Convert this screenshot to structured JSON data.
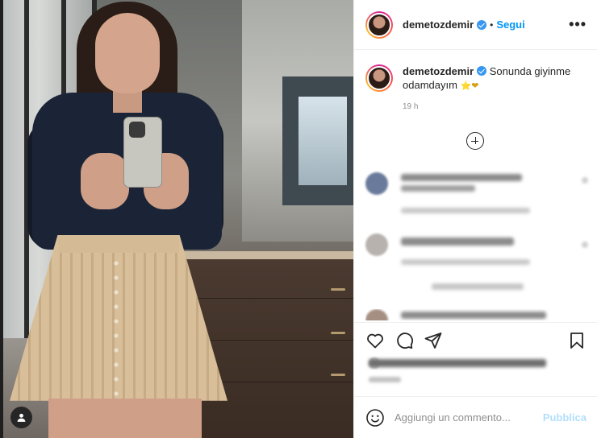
{
  "post": {
    "username": "demetozdemir",
    "follow_label": "Segui",
    "separator": "•",
    "more_label": "•••",
    "caption_text": "Sonunda giyinme odamdayım",
    "caption_emoji": "⭐❤",
    "time_ago": "19 h"
  },
  "composer": {
    "placeholder": "Aggiungi un commento...",
    "publish_label": "Pubblica"
  },
  "icons": {
    "verified": "verified-badge-icon",
    "like": "heart-icon",
    "comment": "comment-icon",
    "share": "share-icon",
    "save": "bookmark-icon",
    "emoji": "smiley-icon",
    "load_more": "plus-circle-icon",
    "tagged_user": "user-tag-icon"
  },
  "colors": {
    "link_blue": "#0095f6",
    "publish_disabled": "#b2dffc",
    "verified_blue": "#3897f0",
    "emoji_heart": "#c0392b",
    "emoji_star": "#f4c430"
  }
}
